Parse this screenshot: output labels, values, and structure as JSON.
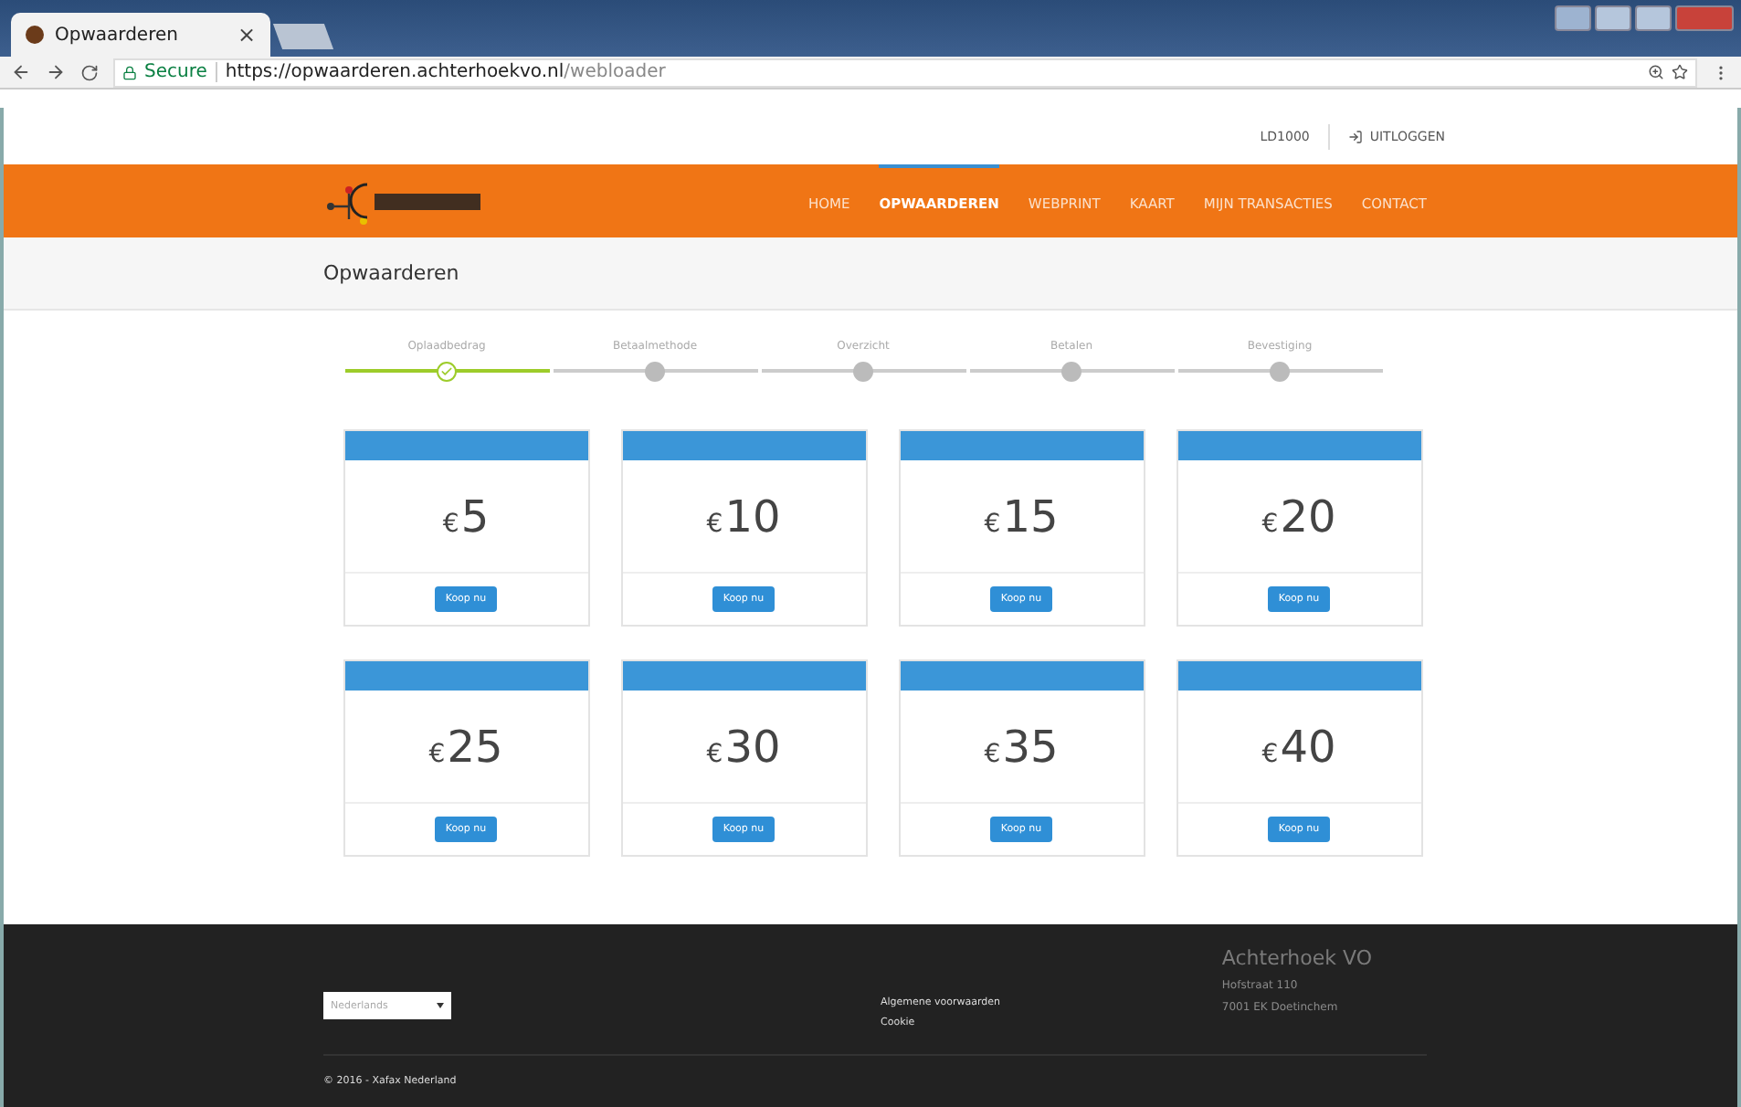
{
  "browser": {
    "tab_title": "Opwaarderen",
    "tab_close": "×",
    "secure_label": "Secure",
    "url_host": "https://opwaarderen.achterhoekvo.nl",
    "url_path": "/webloader"
  },
  "user_bar": {
    "account": "LD1000",
    "logout": "UITLOGGEN"
  },
  "nav": [
    {
      "label": "HOME",
      "selected": false
    },
    {
      "label": "OPWAARDEREN",
      "selected": true
    },
    {
      "label": "WEBPRINT",
      "selected": false
    },
    {
      "label": "KAART",
      "selected": false
    },
    {
      "label": "MIJN TRANSACTIES",
      "selected": false
    },
    {
      "label": "CONTACT",
      "selected": false
    }
  ],
  "page_title": "Opwaarderen",
  "steps": [
    {
      "label": "Oplaadbedrag",
      "selected": true
    },
    {
      "label": "Betaalmethode",
      "selected": false
    },
    {
      "label": "Overzicht",
      "selected": false
    },
    {
      "label": "Betalen",
      "selected": false
    },
    {
      "label": "Bevestiging",
      "selected": false
    }
  ],
  "amounts": [
    {
      "currency": "€",
      "value": "5",
      "button": "Koop nu"
    },
    {
      "currency": "€",
      "value": "10",
      "button": "Koop nu"
    },
    {
      "currency": "€",
      "value": "15",
      "button": "Koop nu"
    },
    {
      "currency": "€",
      "value": "20",
      "button": "Koop nu"
    },
    {
      "currency": "€",
      "value": "25",
      "button": "Koop nu"
    },
    {
      "currency": "€",
      "value": "30",
      "button": "Koop nu"
    },
    {
      "currency": "€",
      "value": "35",
      "button": "Koop nu"
    },
    {
      "currency": "€",
      "value": "40",
      "button": "Koop nu"
    }
  ],
  "footer": {
    "language": "Nederlands",
    "links": [
      "Algemene voorwaarden",
      "Cookie"
    ],
    "org_name": "Achterhoek VO",
    "address": [
      "Hofstraat 110",
      "7001 EK Doetinchem"
    ],
    "copyright": "© 2016 - ",
    "company": "Xafax Nederland"
  }
}
